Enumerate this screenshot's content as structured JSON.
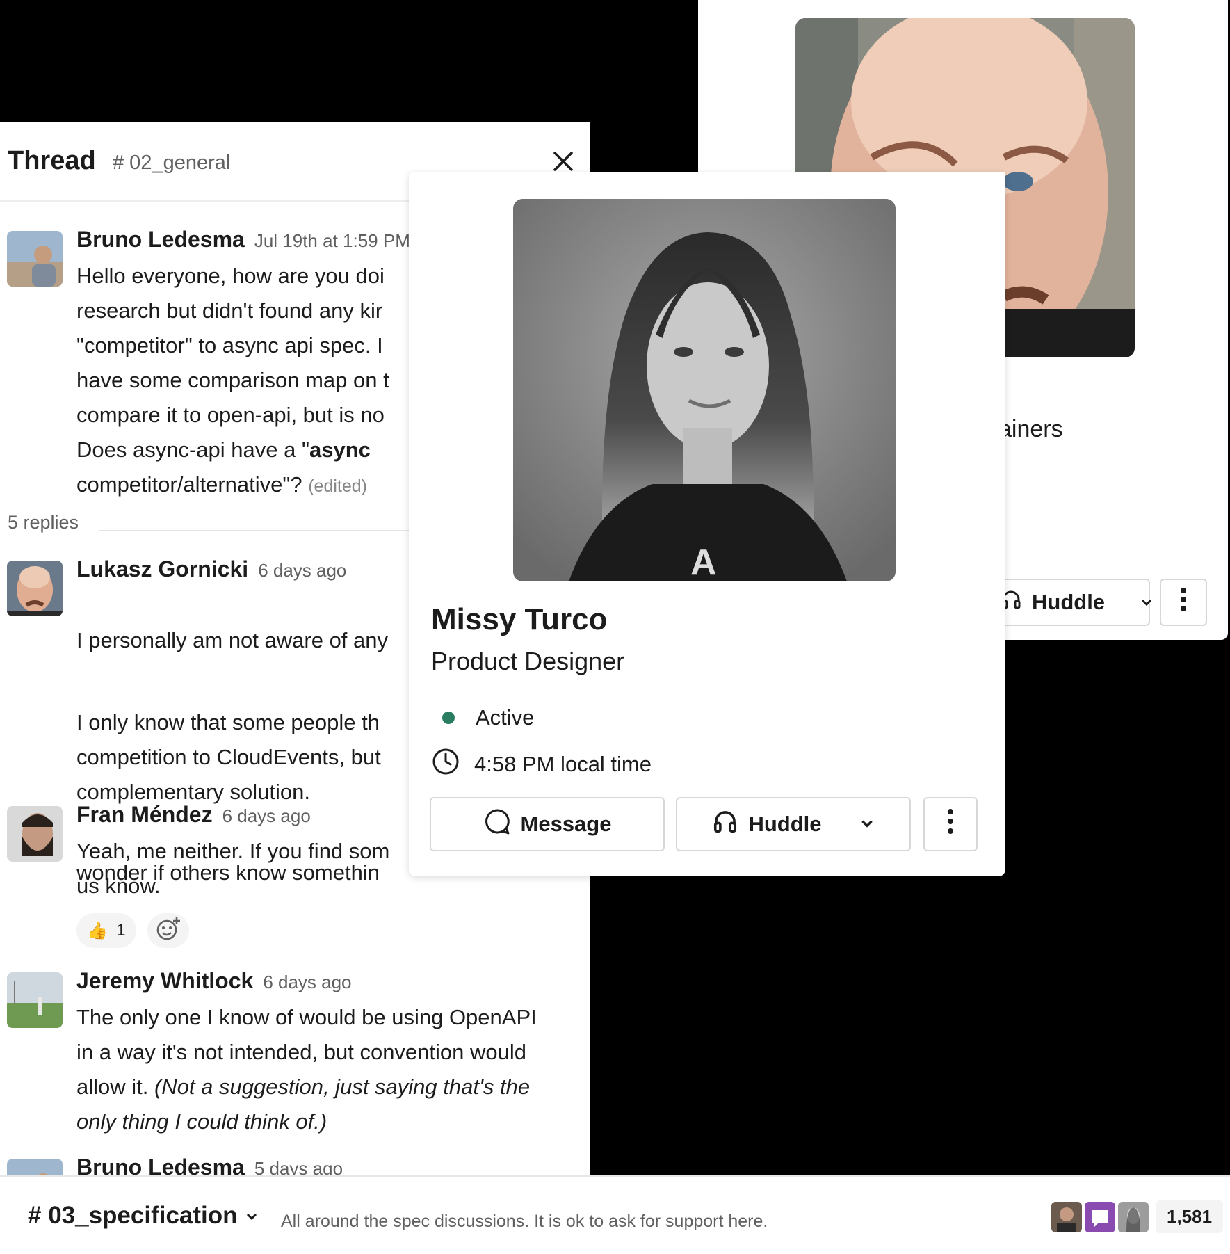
{
  "back_profile": {
    "role_fragment": "ainers",
    "huddle_label": "Huddle"
  },
  "thread": {
    "title": "Thread",
    "channel": "# 02_general",
    "parent": {
      "author": "Bruno Ledesma",
      "time": "Jul 19th at 1:59 PM",
      "lines": [
        "Hello everyone, how are you doi",
        "research but didn't found any kir",
        "\"competitor\" to async api spec. I",
        "have some comparison map on t",
        "compare it to open-api, but is no"
      ],
      "line6_prefix": "Does async-api have a \"",
      "line6_bold": "async",
      "line7_text": "competitor/alternative\"?",
      "edited": "(edited)"
    },
    "replies_count": "5 replies",
    "messages": [
      {
        "author": "Lukasz Gornicki",
        "time": "6 days ago",
        "paragraphs": [
          "I personally am not aware of any",
          "I only know that some people th\ncompetition to CloudEvents, but\ncomplementary solution.",
          "wonder if others know somethin"
        ]
      },
      {
        "author": "Fran Méndez",
        "time": "6 days ago",
        "text": "Yeah, me neither. If you find som\nus know.",
        "reaction_emoji": "👍",
        "reaction_count": "1"
      },
      {
        "author": "Jeremy Whitlock",
        "time": "6 days ago",
        "text": "The only one I know of would be using OpenAPI\nin a way it's not intended, but convention would\nallow it. ",
        "italic": "(Not a suggestion, just saying that's the\nonly thing I could think of.)"
      },
      {
        "author": "Bruno Ledesma",
        "time": "5 days ago"
      }
    ]
  },
  "profile": {
    "name": "Missy Turco",
    "title": "Product Designer",
    "status": "Active",
    "local_time": "4:58 PM local time",
    "message_label": "Message",
    "huddle_label": "Huddle"
  },
  "channel_bar": {
    "channel": "# 03_specification",
    "description": "All around the spec discussions. It is ok to ask for support here.",
    "member_count": "1,581"
  },
  "colors": {
    "status_active": "#2b7d62",
    "text_primary": "#1d1c1d",
    "text_secondary": "#616061",
    "background_outside": "#000000"
  }
}
